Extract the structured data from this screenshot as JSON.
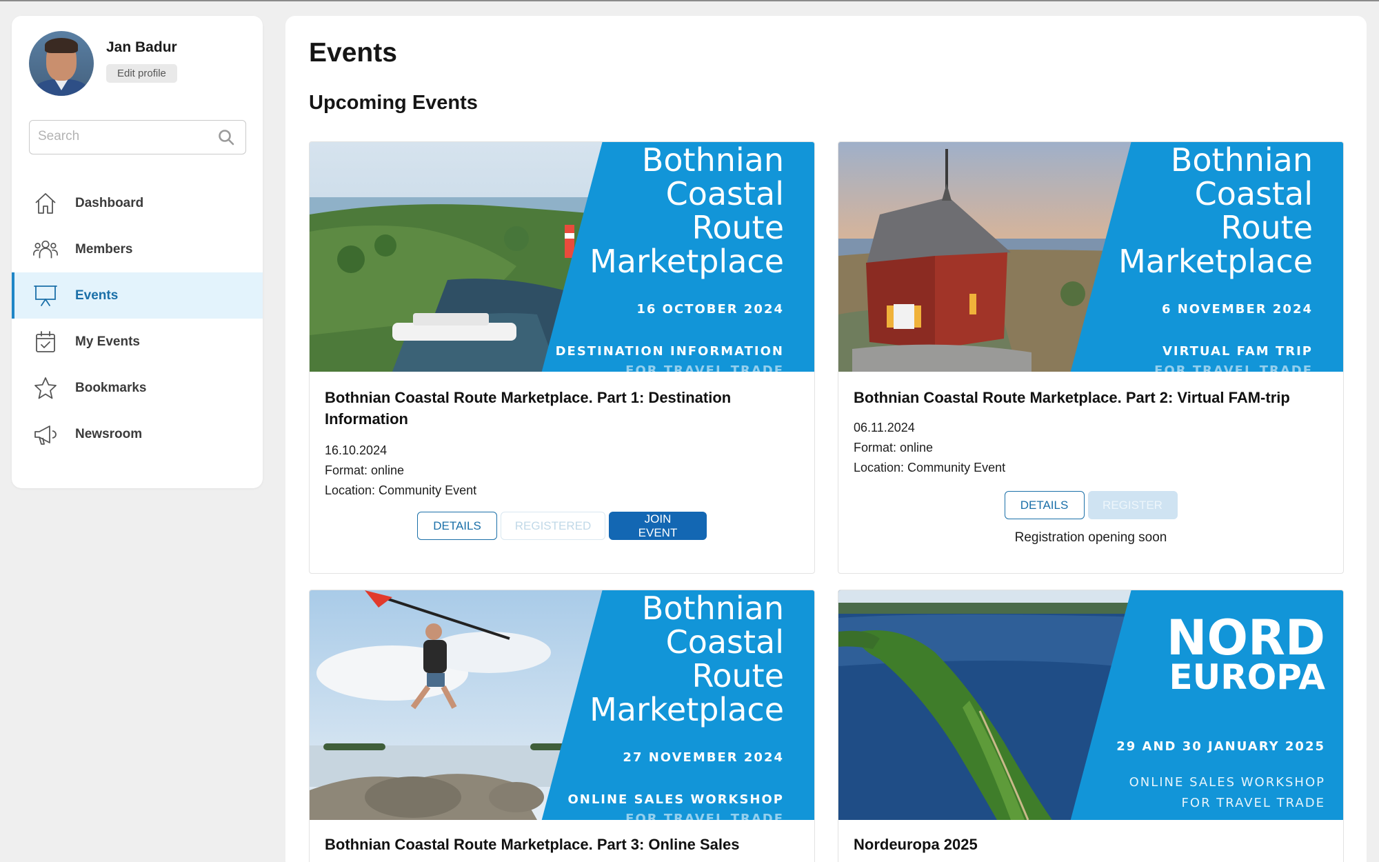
{
  "profile": {
    "name": "Jan Badur",
    "edit_label": "Edit profile"
  },
  "search": {
    "placeholder": "Search"
  },
  "sidebar": {
    "items": [
      {
        "label": "Dashboard",
        "icon": "home-icon",
        "active": false
      },
      {
        "label": "Members",
        "icon": "members-icon",
        "active": false
      },
      {
        "label": "Events",
        "icon": "presentation-icon",
        "active": true
      },
      {
        "label": "My Events",
        "icon": "calendar-check-icon",
        "active": false
      },
      {
        "label": "Bookmarks",
        "icon": "star-icon",
        "active": false
      },
      {
        "label": "Newsroom",
        "icon": "megaphone-icon",
        "active": false
      }
    ]
  },
  "colors": {
    "accent": "#1f86c7",
    "active_bg": "#e3f3fc",
    "banner_blue": "#1295d8",
    "button_primary": "#1367b3"
  },
  "page": {
    "title": "Events",
    "section_title": "Upcoming Events"
  },
  "events": [
    {
      "banner": {
        "title_lines": [
          "Bothnian",
          "Coastal",
          "Route",
          "Marketplace"
        ],
        "date": "16 OCTOBER 2024",
        "subtitle": "DESTINATION INFORMATION",
        "subtitle2": "FOR TRAVEL TRADE"
      },
      "title": "Bothnian Coastal Route Marketplace. Part 1: Destination Information",
      "date": "16.10.2024",
      "format": "Format: online",
      "location": "Location: Community Event",
      "buttons": {
        "details": "DETAILS",
        "registered": "REGISTERED",
        "join": "JOIN EVENT"
      }
    },
    {
      "banner": {
        "title_lines": [
          "Bothnian",
          "Coastal",
          "Route",
          "Marketplace"
        ],
        "date": "6 NOVEMBER 2024",
        "subtitle": "VIRTUAL FAM TRIP",
        "subtitle2": "FOR TRAVEL TRADE"
      },
      "title": "Bothnian Coastal Route Marketplace. Part 2: Virtual FAM-trip",
      "date": "06.11.2024",
      "format": "Format: online",
      "location": "Location: Community Event",
      "buttons": {
        "details": "DETAILS",
        "register": "REGISTER"
      },
      "note": "Registration opening soon"
    },
    {
      "banner": {
        "title_lines": [
          "Bothnian",
          "Coastal",
          "Route",
          "Marketplace"
        ],
        "date": "27 NOVEMBER 2024",
        "subtitle": "ONLINE SALES WORKSHOP",
        "subtitle2": "FOR TRAVEL TRADE"
      },
      "title": "Bothnian Coastal Route Marketplace. Part 3: Online Sales"
    },
    {
      "banner": {
        "title_lines": [
          "NORD",
          "EUROPA"
        ],
        "date": "29 AND 30 JANUARY 2025",
        "subtitle": "ONLINE SALES WORKSHOP",
        "subtitle2": "FOR TRAVEL TRADE"
      },
      "title": "Nordeuropa 2025"
    }
  ]
}
